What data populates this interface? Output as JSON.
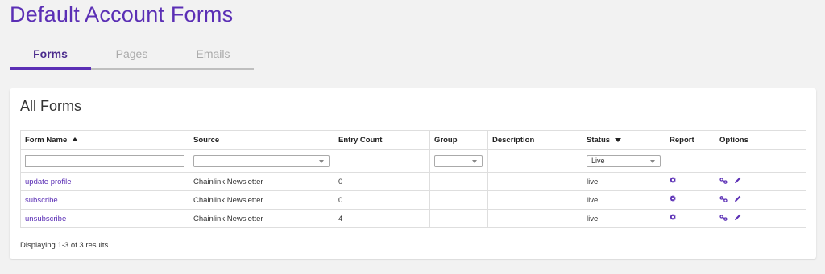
{
  "page": {
    "title": "Default Account Forms"
  },
  "tabs": [
    {
      "label": "Forms",
      "active": true
    },
    {
      "label": "Pages",
      "active": false
    },
    {
      "label": "Emails",
      "active": false
    }
  ],
  "card": {
    "title": "All Forms"
  },
  "table": {
    "headers": {
      "form_name": "Form Name",
      "source": "Source",
      "entry_count": "Entry Count",
      "group": "Group",
      "description": "Description",
      "status": "Status",
      "report": "Report",
      "options": "Options"
    },
    "filters": {
      "form_name_value": "",
      "source_value": "",
      "group_value": "",
      "status_value": "Live"
    },
    "rows": [
      {
        "form_name": "update profile",
        "source": "Chainlink Newsletter",
        "entry_count": "0",
        "group": "",
        "description": "",
        "status": "live"
      },
      {
        "form_name": "subscribe",
        "source": "Chainlink Newsletter",
        "entry_count": "0",
        "group": "",
        "description": "",
        "status": "live"
      },
      {
        "form_name": "unsubscribe",
        "source": "Chainlink Newsletter",
        "entry_count": "4",
        "group": "",
        "description": "",
        "status": "live"
      }
    ]
  },
  "footer": {
    "summary": "Displaying 1-3 of 3 results."
  },
  "colors": {
    "accent": "#5b2fb5",
    "background": "#f2f2f2",
    "card": "#ffffff",
    "tab_inactive": "#aaaaaa"
  },
  "icons": {
    "report": "gear-icon",
    "options": [
      "link-icon",
      "pencil-icon"
    ]
  }
}
